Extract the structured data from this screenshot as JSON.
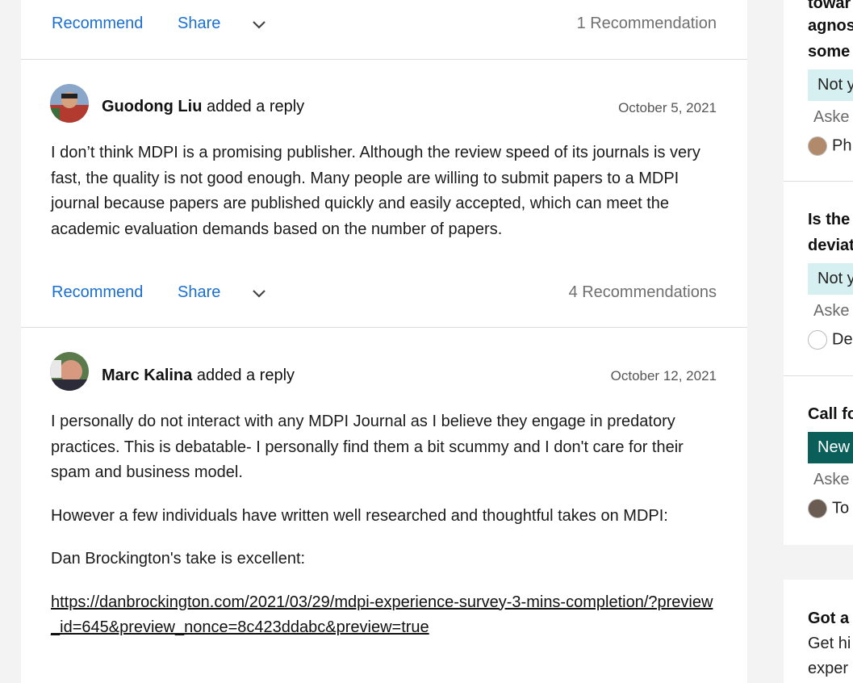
{
  "top_actions": {
    "recommend": "Recommend",
    "share": "Share",
    "count": "1 Recommendation"
  },
  "replies": [
    {
      "author": "Guodong Liu",
      "action": "added a reply",
      "date": "October 5, 2021",
      "paragraphs": [
        "I don’t think MDPI is a promising publisher. Although the review speed of its journals is very fast, the quality is not good enough. Many people are willing to submit papers to a MDPI journal because papers are published quickly and easily accepted, which can meet the academic evaluation demands based on the number of papers."
      ],
      "recommend": "Recommend",
      "share": "Share",
      "count": "4 Recommendations"
    },
    {
      "author": "Marc Kalina",
      "action": "added a reply",
      "date": "October 12, 2021",
      "paragraphs": [
        "I personally do not interact with any MDPI Journal as I believe they engage in predatory practices. This is debatable- I personally find them a bit scummy and I don't care for their spam and business model.",
        "However a few individuals have written well researched and thoughtful takes on MDPI:",
        "Dan Brockington's take is excellent:"
      ],
      "link": "https://danbrockington.com/2021/03/29/mdpi-experience-survey-3-mins-completion/?preview_id=645&preview_nonce=8c423ddabc&preview=true"
    }
  ],
  "sidebar": {
    "q1": {
      "lines": [
        "towar",
        "agnos",
        "some"
      ],
      "badge": "Not y",
      "asked": "Aske",
      "user": "Ph"
    },
    "q2": {
      "lines": [
        "Is the",
        "deviat"
      ],
      "badge": "Not y",
      "asked": "Aske",
      "user": "De"
    },
    "q3": {
      "lines": [
        "Call fo"
      ],
      "badge": "New",
      "asked": "Aske",
      "user": "To"
    },
    "promo": {
      "lines": [
        "Got a",
        "Get hi",
        "exper"
      ]
    }
  },
  "colors": {
    "link_blue": "#1a6fd0",
    "badge_light": "#d6eff0",
    "badge_dark": "#0a5f5a"
  },
  "icons": {
    "chevron": "chevron-down-icon"
  }
}
